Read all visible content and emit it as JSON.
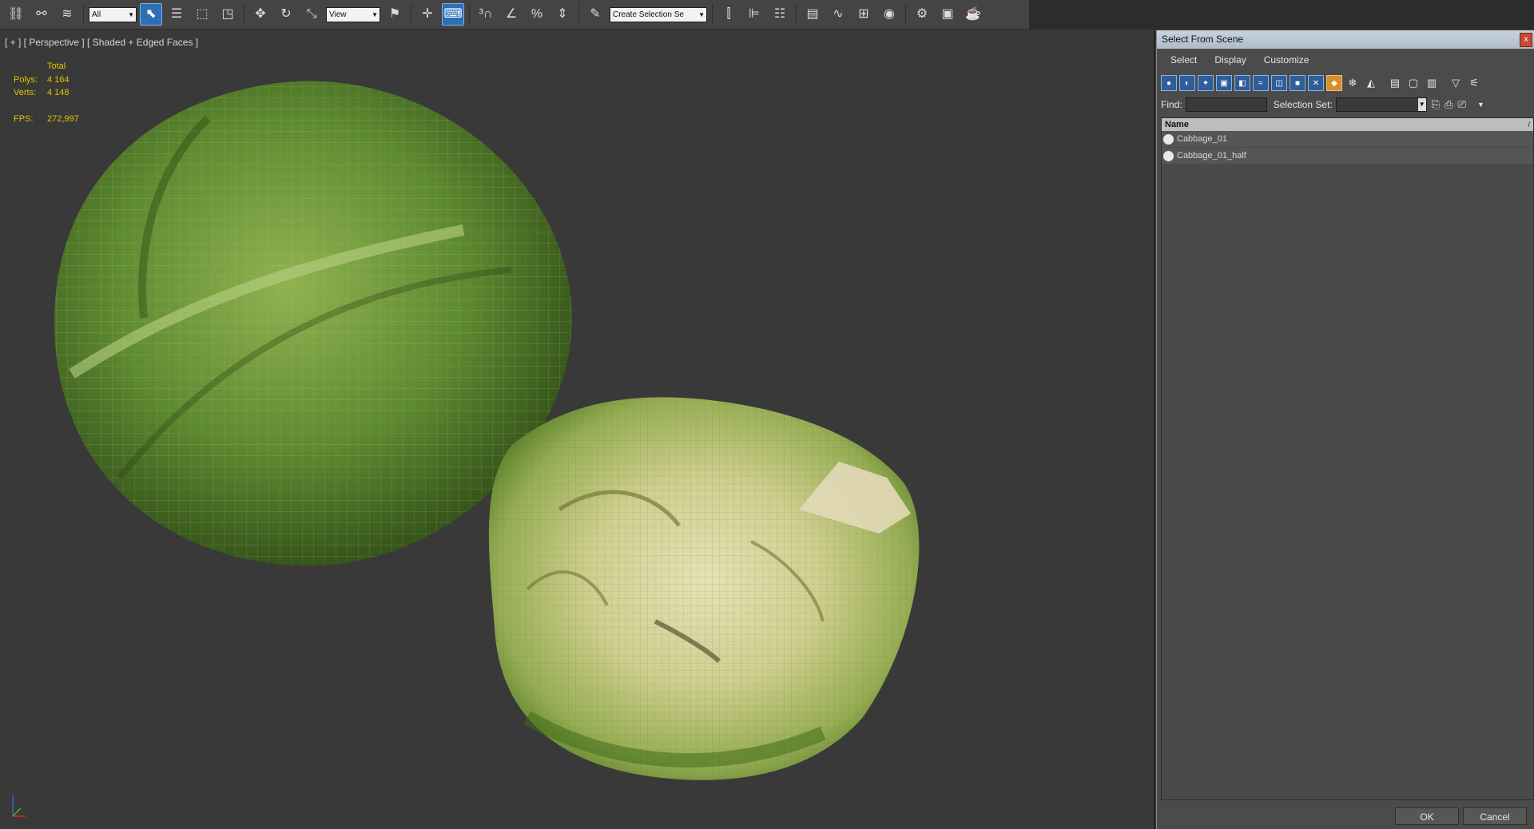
{
  "toolbar": {
    "selection_filter": "All",
    "ref_coord": "View",
    "named_selection_placeholder": "Create Selection Se",
    "icons": [
      "select-and-link-icon",
      "unlink-icon",
      "bind-space-warp-icon",
      "select-object-icon",
      "select-by-name-icon",
      "rectangular-region-icon",
      "window-crossing-icon",
      "move-icon",
      "rotate-icon",
      "scale-icon",
      "pivot-icon",
      "manipulate-icon",
      "keyboard-shortcut-icon",
      "snaps-icon",
      "angle-snap-icon",
      "percent-snap-icon",
      "spinner-snap-icon",
      "edit-named-sets-icon",
      "mirror-icon",
      "align-icon",
      "layer-manager-icon",
      "scene-explorer-icon",
      "curve-editor-icon",
      "schematic-view-icon",
      "material-editor-icon",
      "render-setup-icon",
      "rendered-frame-icon",
      "render-icon"
    ]
  },
  "viewport": {
    "label": "[ + ] [ Perspective ] [ Shaded + Edged Faces ]",
    "stats": {
      "total_label": "Total",
      "polys_label": "Polys:",
      "polys_value": "4 164",
      "verts_label": "Verts:",
      "verts_value": "4 148",
      "fps_label": "FPS:",
      "fps_value": "272,997"
    }
  },
  "dialog": {
    "title": "Select From Scene",
    "close_label": "x",
    "menu": [
      "Select",
      "Display",
      "Customize"
    ],
    "find_label": "Find:",
    "find_value": "",
    "selection_set_label": "Selection Set:",
    "list_header": "Name",
    "items": [
      "Cabbage_01",
      "Cabbage_01_half"
    ],
    "ok_label": "OK",
    "cancel_label": "Cancel"
  },
  "colors": {
    "stats_text": "#e3c300",
    "viewport_bg": "#393939",
    "active_button": "#2d6fb5",
    "cabbage_green": "#5d8a32"
  }
}
